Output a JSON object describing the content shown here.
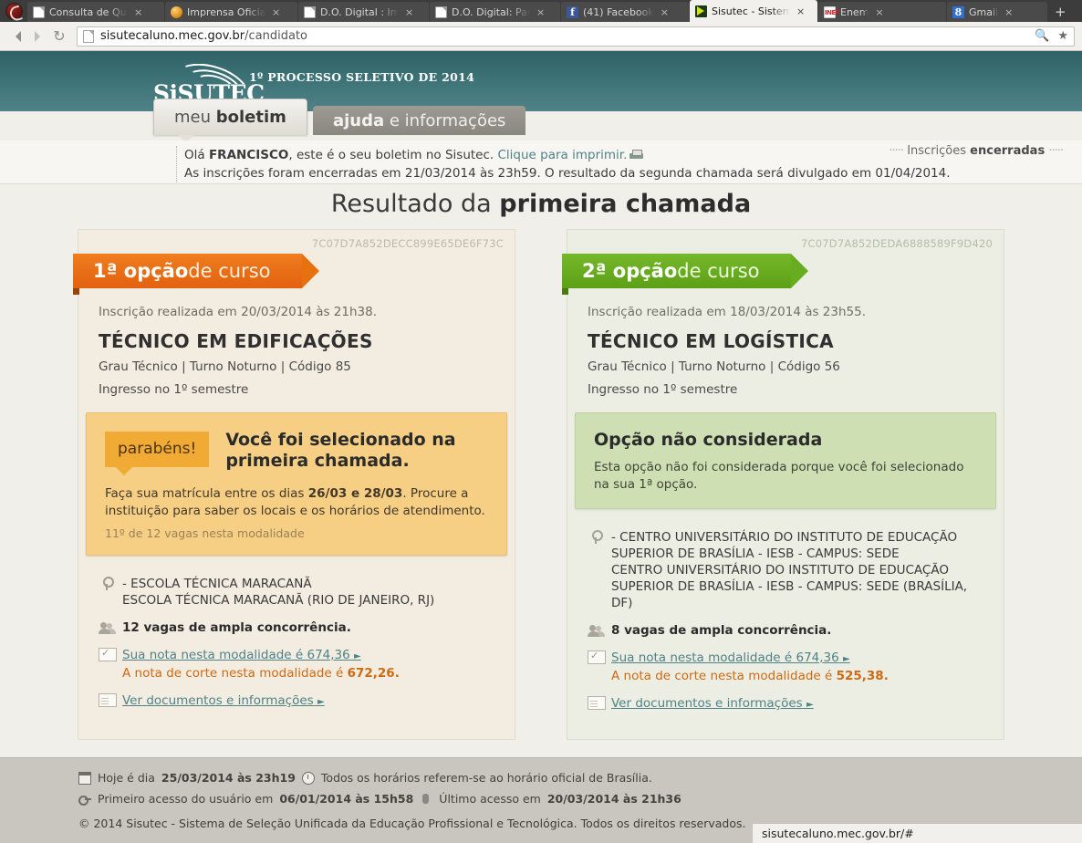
{
  "browser": {
    "tabs": [
      {
        "title": "Consulta de Qua",
        "favicon": "document-icon",
        "active": false
      },
      {
        "title": "Imprensa Oficial",
        "favicon": "globe-icon",
        "active": false
      },
      {
        "title": "D.O. Digital : Imp",
        "favicon": "document-icon",
        "active": false
      },
      {
        "title": "D.O. Digital: Part",
        "favicon": "document-icon",
        "active": false
      },
      {
        "title": "(41) Facebook",
        "favicon": "facebook-icon",
        "active": false
      },
      {
        "title": "Sisutec - Sistema",
        "favicon": "sisutec-icon",
        "active": true
      },
      {
        "title": "Enem",
        "favicon": "inep-icon",
        "active": false
      },
      {
        "title": "Gmail",
        "favicon": "gmail-icon",
        "active": false
      }
    ],
    "new_tab_label": "+",
    "close_label": "×",
    "url_host": "sisutecaluno.mec.gov.br",
    "url_path": "/candidato",
    "back_label": "Voltar",
    "forward_label": "Avançar",
    "reload_label": "↻",
    "zoom_icon_label": "zoom",
    "bookmark_icon_label": "★",
    "status_bar_url": "sisutecaluno.mec.gov.br/#"
  },
  "header": {
    "logo_text": "SiSUTEC",
    "title": "1º PROCESSO SELETIVO DE 2014",
    "tabs": [
      {
        "strong": "boletim",
        "light": "meu",
        "active": true
      },
      {
        "strong": "ajuda",
        "light": "e informações",
        "active": false
      }
    ]
  },
  "notice": {
    "greeting_pre": "Olá ",
    "greeting_name": "FRANCISCO",
    "greeting_post": ", este é o seu boletim no Sisutec. ",
    "print_link": "Clique para imprimir.",
    "line2": "As inscrições foram encerradas em 21/03/2014 às 23h59. O resultado da segunda chamada será divulgado em 01/04/2014.",
    "badge_light": "Inscrições ",
    "badge_strong": "encerradas",
    "badge_dots": "·····"
  },
  "result_title": {
    "light": "Resultado da ",
    "strong": "primeira chamada"
  },
  "cards": [
    {
      "hash": "7C07D7A852DECC899E65DE6F73C",
      "ribbon_strong": "1ª opção",
      "ribbon_light": " de curso",
      "inscription": "Inscrição realizada em 20/03/2014 às 21h38.",
      "course": "TÉCNICO EM EDIFICAÇÕES",
      "meta1": "Grau Técnico | Turno Noturno | Código 85",
      "meta2": "Ingresso no 1º semestre",
      "status": {
        "kind": "selected",
        "badge": "parabéns!",
        "headline": "Você foi selecionado na primeira chamada.",
        "detail_pre": "Faça sua matrícula entre os dias ",
        "detail_dates": "26/03 e 28/03",
        "detail_post": ". Procure a instituição para saber os locais e os horários de atendimento.",
        "position": "11º de 12 vagas nesta modalidade"
      },
      "institution_line1": "- ESCOLA TÉCNICA MARACANÃ",
      "institution_line2": "ESCOLA TÉCNICA MARACANÃ (RIO DE JANEIRO, RJ)",
      "vagas": "12 vagas de ampla concorrência.",
      "nota_link": "Sua nota nesta modalidade é 674,36",
      "corte_pre": "A nota de corte nesta modalidade é ",
      "corte_value": "672,26.",
      "docs_link": "Ver documentos e informações"
    },
    {
      "hash": "7C07D7A852DEDA6888589F9D420",
      "ribbon_strong": "2ª opção",
      "ribbon_light": " de curso",
      "inscription": "Inscrição realizada em 18/03/2014 às 23h55.",
      "course": "TÉCNICO EM LOGÍSTICA",
      "meta1": "Grau Técnico | Turno Noturno | Código 56",
      "meta2": "Ingresso no 1º semestre",
      "status": {
        "kind": "not-considered",
        "headline": "Opção não considerada",
        "detail": "Esta opção não foi considerada porque você foi selecionado na sua 1ª opção."
      },
      "institution_line1": "- CENTRO UNIVERSITÁRIO DO INSTITUTO DE EDUCAÇÃO SUPERIOR DE BRASÍLIA - IESB - CAMPUS: SEDE",
      "institution_line2": "CENTRO UNIVERSITÁRIO DO INSTITUTO DE EDUCAÇÃO SUPERIOR DE BRASÍLIA - IESB - CAMPUS: SEDE (BRASÍLIA, DF)",
      "vagas": "8 vagas de ampla concorrência.",
      "nota_link": "Sua nota nesta modalidade é 674,36",
      "corte_pre": "A nota de corte nesta modalidade é ",
      "corte_value": "525,38.",
      "docs_link": "Ver documentos e informações"
    }
  ],
  "footer": {
    "today_pre": "Hoje é dia ",
    "today_value": "25/03/2014 às 23h19",
    "timezone_note": "Todos os horários referem-se ao horário oficial de Brasília.",
    "first_access_pre": "Primeiro acesso do usuário em ",
    "first_access_value": "06/01/2014 às 15h58",
    "last_access_pre": "Último acesso em ",
    "last_access_value": "20/03/2014 às 21h36",
    "copyright": "© 2014 Sisutec - Sistema de Seleção Unificada da Educação Profissional e Tecnológica. Todos os direitos reservados."
  },
  "colors": {
    "header_teal": "#3c7276",
    "ribbon_orange": "#e7700f",
    "ribbon_green": "#68ac20",
    "amber_box": "#f6cf84",
    "green_box": "#cfdfb4",
    "link_teal": "#4f8286",
    "corte_orange": "#cf6a10"
  }
}
